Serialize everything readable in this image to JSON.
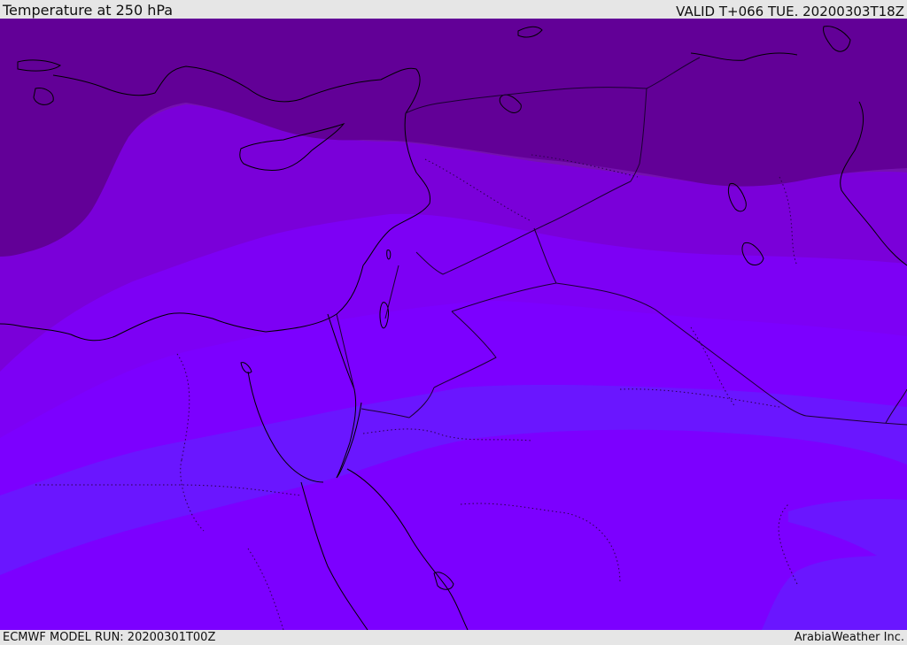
{
  "header": {
    "title": "Temperature at 250 hPa",
    "valid": "VALID T+066 TUE. 20200303T18Z"
  },
  "footer": {
    "model_run": "ECMWF MODEL RUN: 20200301T00Z",
    "credit": "ArabiaWeather Inc."
  },
  "map": {
    "bands": [
      {
        "name": "band-1",
        "color": "#620097"
      },
      {
        "name": "band-2",
        "color": "#7511b0"
      },
      {
        "name": "band-3",
        "color": "#7a00d9"
      },
      {
        "name": "band-4",
        "color": "#7d00f5"
      },
      {
        "name": "band-5",
        "color": "#6a16ff"
      },
      {
        "name": "band-6",
        "color": "#7c00ff"
      }
    ],
    "coastline_color": "#000000",
    "border_color": "#1a0030"
  }
}
